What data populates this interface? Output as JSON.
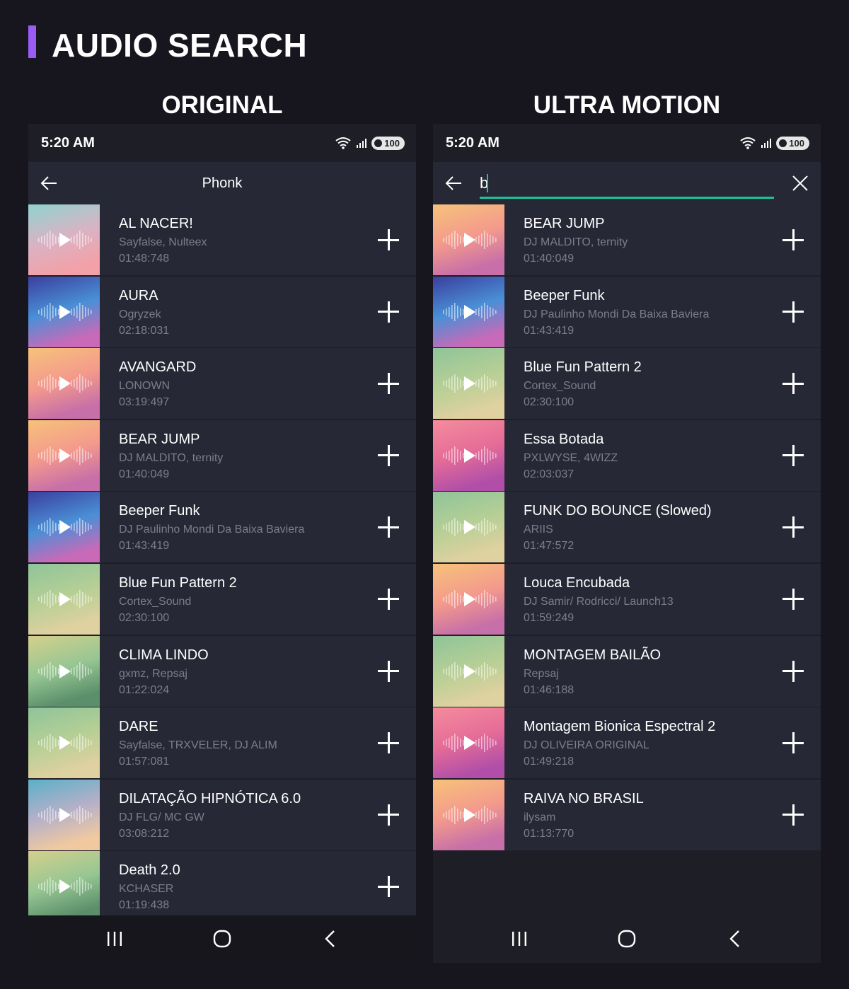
{
  "page": {
    "title": "AUDIO SEARCH",
    "accent": "#9b5cf6"
  },
  "columns": {
    "left": "ORIGINAL",
    "right": "ULTRA MOTION"
  },
  "status": {
    "time": "5:20 AM",
    "battery": "100",
    "wifi_badge": "6"
  },
  "left_screen": {
    "app_title": "Phonk",
    "tracks": [
      {
        "name": "AL NACER!",
        "artist": "Sayfalse, Nulteex",
        "duration": "01:48:748",
        "thumb": "pastel"
      },
      {
        "name": "AURA",
        "artist": "Ogryzek",
        "duration": "02:18:031",
        "thumb": "blue"
      },
      {
        "name": "AVANGARD",
        "artist": "LONOWN",
        "duration": "03:19:497",
        "thumb": "sunset"
      },
      {
        "name": "BEAR JUMP",
        "artist": "DJ MALDITO, ternity",
        "duration": "01:40:049",
        "thumb": "sunset"
      },
      {
        "name": "Beeper Funk",
        "artist": "DJ Paulinho Mondi Da Baixa Baviera",
        "duration": "01:43:419",
        "thumb": "blue"
      },
      {
        "name": "Blue Fun Pattern 2",
        "artist": "Cortex_Sound",
        "duration": "02:30:100",
        "thumb": "green"
      },
      {
        "name": "CLIMA LINDO",
        "artist": "gxmz, Repsaj",
        "duration": "01:22:024",
        "thumb": "olive"
      },
      {
        "name": "DARE",
        "artist": "Sayfalse, TRXVELER, DJ ALIM",
        "duration": "01:57:081",
        "thumb": "green"
      },
      {
        "name": "DILATAÇÃO HIPNÓTICA 6.0",
        "artist": "DJ FLG/ MC GW",
        "duration": "03:08:212",
        "thumb": "teal"
      },
      {
        "name": "Death 2.0",
        "artist": "KCHASER",
        "duration": "01:19:438",
        "thumb": "olive"
      }
    ]
  },
  "right_screen": {
    "search_value": "b",
    "tracks": [
      {
        "name": "BEAR JUMP",
        "artist": "DJ MALDITO, ternity",
        "duration": "01:40:049",
        "thumb": "sunset"
      },
      {
        "name": "Beeper Funk",
        "artist": "DJ Paulinho Mondi Da Baixa Baviera",
        "duration": "01:43:419",
        "thumb": "blue"
      },
      {
        "name": "Blue Fun Pattern 2",
        "artist": "Cortex_Sound",
        "duration": "02:30:100",
        "thumb": "green"
      },
      {
        "name": "Essa Botada",
        "artist": "PXLWYSE, 4WIZZ",
        "duration": "02:03:037",
        "thumb": "pink"
      },
      {
        "name": "FUNK DO BOUNCE (Slowed)",
        "artist": "ARIIS",
        "duration": "01:47:572",
        "thumb": "green"
      },
      {
        "name": "Louca Encubada",
        "artist": "DJ Samir/ Rodricci/ Launch13",
        "duration": "01:59:249",
        "thumb": "sunset"
      },
      {
        "name": "MONTAGEM BAILÃO",
        "artist": "Repsaj",
        "duration": "01:46:188",
        "thumb": "green"
      },
      {
        "name": "Montagem Bionica Espectral 2",
        "artist": "DJ OLIVEIRA ORIGINAL",
        "duration": "01:49:218",
        "thumb": "pink"
      },
      {
        "name": "RAIVA NO BRASIL",
        "artist": "ilysam",
        "duration": "01:13:770",
        "thumb": "sunset"
      }
    ]
  },
  "thumb_palettes": {
    "pastel": [
      "#8fd3d0",
      "#d9b3c4",
      "#f2a1a8"
    ],
    "blue": [
      "#3a3f9e",
      "#4a8fd6",
      "#c86ab8"
    ],
    "sunset": [
      "#f6c27a",
      "#f49a8c",
      "#c76fa8"
    ],
    "green": [
      "#8fc49a",
      "#b6cf95",
      "#e0d1a0"
    ],
    "olive": [
      "#d4d08c",
      "#97c693",
      "#5b8f6b"
    ],
    "teal": [
      "#5ab0c8",
      "#b6b0c8",
      "#f0c9a0"
    ],
    "pink": [
      "#f58c9c",
      "#e56c98",
      "#b14fa8"
    ]
  }
}
